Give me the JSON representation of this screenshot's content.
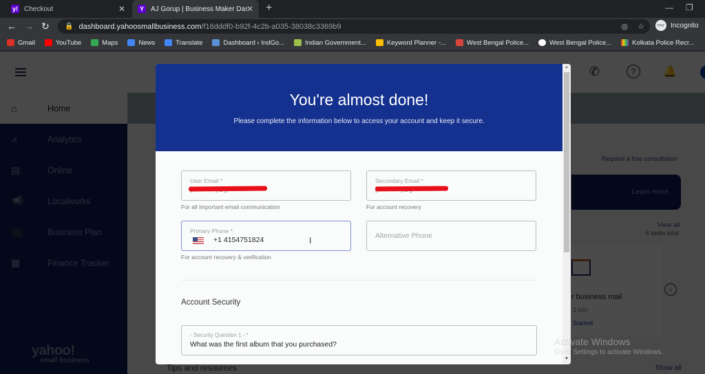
{
  "browser": {
    "tabs": [
      {
        "title": "Checkout",
        "favicon": "yahoo-favicon",
        "active": false
      },
      {
        "title": "AJ Gorup | Business Maker Dashl",
        "favicon": "yahoo-favicon",
        "active": true
      }
    ],
    "new_tab_label": "+",
    "window_controls": {
      "minimize": "—",
      "restore": "❐"
    },
    "address": {
      "host": "dashboard.yahoosmallbusiness.com",
      "path": "/f16dddf0-b92f-4c2b-a035-38038c3369b9"
    },
    "profile_label": "Incognito",
    "bookmarks": [
      {
        "label": "Gmail",
        "color": "#d93025"
      },
      {
        "label": "YouTube",
        "color": "#ff0000"
      },
      {
        "label": "Maps",
        "color": "#34a853"
      },
      {
        "label": "News",
        "color": "#4285f4"
      },
      {
        "label": "Translate",
        "color": "#4285f4"
      },
      {
        "label": "Dashboard ‹ IndGo...",
        "color": "#5b8fd8"
      },
      {
        "label": "Indian Government...",
        "color": "#9bbf4a"
      },
      {
        "label": "Keyword Planner -...",
        "color": "#fbbc04"
      },
      {
        "label": "West Bengal Police...",
        "color": "#d6453a"
      },
      {
        "label": "West Bengal Police...",
        "color": "#ffffff"
      },
      {
        "label": "Kolkata Police Recr...",
        "color": "#c0392b"
      }
    ]
  },
  "app": {
    "sidebar": {
      "items": [
        {
          "label": "Home",
          "icon": "⌂"
        },
        {
          "label": "Analytics",
          "icon": "⩘"
        },
        {
          "label": "Online",
          "icon": "▤"
        },
        {
          "label": "Localworks",
          "icon": "📢"
        },
        {
          "label": "Business Plan",
          "icon": "💼"
        },
        {
          "label": "Finance Tracker",
          "icon": "▦"
        }
      ],
      "logo_line1": "yahoo!",
      "logo_line2": "small business"
    },
    "header_icons": {
      "phone": "✆",
      "help": "?",
      "bell": "🔔"
    },
    "request_consultation": "Request a free consultation",
    "learn_more": "Learn more",
    "view_all": "View all",
    "tasks_total": "6 tasks total",
    "task_card": {
      "title": "r business mail",
      "duration": "2 min",
      "action": "Started"
    },
    "tips_title": "Tips and resources",
    "show_all": "Show all"
  },
  "modal": {
    "title": "You're almost done!",
    "subtitle": "Please complete the information below to access your account and keep it secure.",
    "fields": {
      "user_email": {
        "label": "User Email *",
        "value": "[redacted]@gmail.com",
        "helper": "For all important email communication"
      },
      "secondary_email": {
        "label": "Secondary Email *",
        "value": "[redacted]@gmail.com",
        "helper": "For account recovery"
      },
      "primary_phone": {
        "label": "Primary Phone *",
        "value": "+1 4154751824",
        "country": "US",
        "helper": "For account recovery & verification"
      },
      "alternative_phone": {
        "placeholder": "Alternative Phone"
      }
    },
    "section_title": "Account Security",
    "security_question_1": {
      "label": "- Security Question 1 - *",
      "value": "What was the first album that you purchased?"
    }
  },
  "os_watermark": {
    "line1": "Activate Windows",
    "line2": "Go to Settings to activate Windows."
  }
}
